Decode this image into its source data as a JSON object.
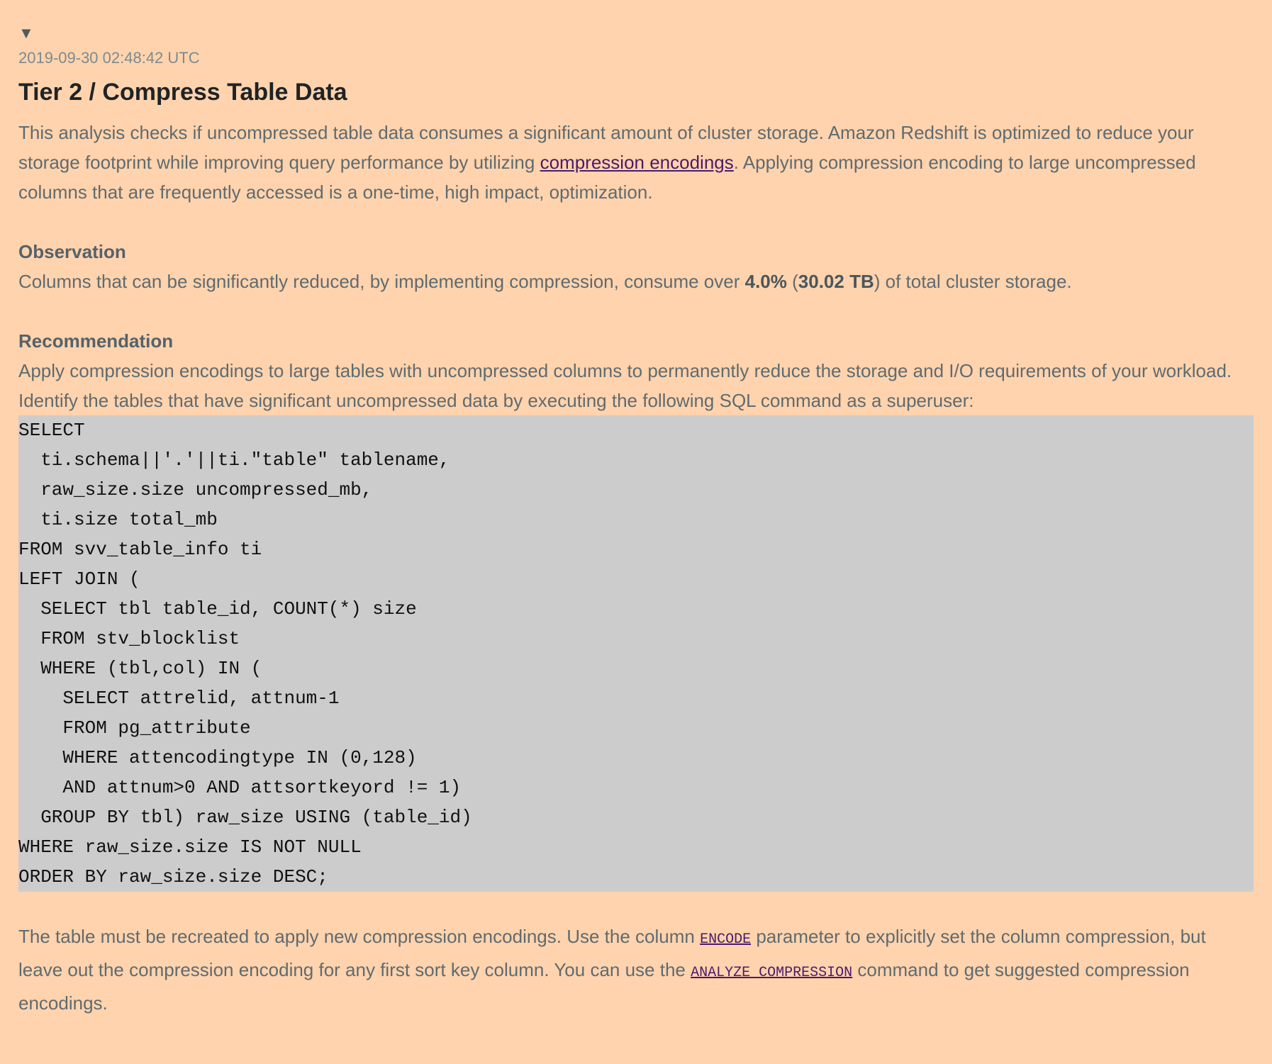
{
  "toggle_icon": "▼",
  "timestamp": "2019-09-30 02:48:42 UTC",
  "title": "Tier 2 / Compress Table Data",
  "intro": {
    "before_link": "This analysis checks if uncompressed table data consumes a significant amount of cluster storage. Amazon Redshift is optimized to reduce your storage footprint while improving query performance by utilizing ",
    "link_text": "compression encodings",
    "after_link": ". Applying compression encoding to large uncompressed columns that are frequently accessed is a one-time, high impact, optimization."
  },
  "observation": {
    "heading": "Observation",
    "text_1": "Columns that can be significantly reduced, by implementing compression, consume over ",
    "percent": "4.0%",
    "text_2": " (",
    "size": "30.02 TB",
    "text_3": ") of total cluster storage."
  },
  "recommendation": {
    "heading": "Recommendation",
    "text": "Apply compression encodings to large tables with uncompressed columns to permanently reduce the storage and I/O requirements of your workload. Identify the tables that have significant uncompressed data by executing the following SQL command as a superuser:"
  },
  "sql": "SELECT\n  ti.schema||'.'||ti.\"table\" tablename,\n  raw_size.size uncompressed_mb,\n  ti.size total_mb\nFROM svv_table_info ti\nLEFT JOIN (\n  SELECT tbl table_id, COUNT(*) size\n  FROM stv_blocklist\n  WHERE (tbl,col) IN (\n    SELECT attrelid, attnum-1\n    FROM pg_attribute\n    WHERE attencodingtype IN (0,128)\n    AND attnum>0 AND attsortkeyord != 1)\n  GROUP BY tbl) raw_size USING (table_id)\nWHERE raw_size.size IS NOT NULL\nORDER BY raw_size.size DESC;",
  "closing": {
    "text_1": "The table must be recreated to apply new compression encodings. Use the column ",
    "encode_link": "ENCODE",
    "text_2": " parameter to explicitly set the column compression, but leave out the compression encoding for any first sort key column. You can use the ",
    "analyze_link": "ANALYZE COMPRESSION",
    "text_3": " command to get suggested compression encodings."
  }
}
